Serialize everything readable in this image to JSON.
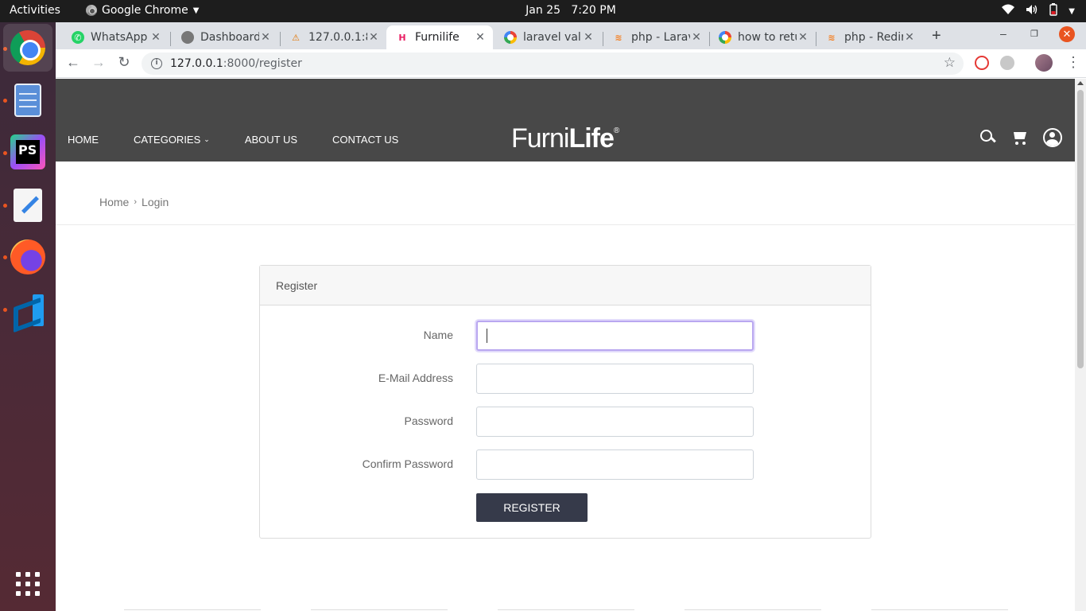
{
  "os": {
    "activities": "Activities",
    "app_name": "Google Chrome",
    "date": "Jan 25",
    "time": "7:20 PM"
  },
  "browser": {
    "tabs": [
      {
        "label": "WhatsApp",
        "icon": "whatsapp-icon"
      },
      {
        "label": "Dashboard",
        "icon": "globe-icon"
      },
      {
        "label": "127.0.0.1:8",
        "icon": "warning-icon"
      },
      {
        "label": "Furnilife",
        "icon": "furnilife-icon",
        "active": true
      },
      {
        "label": "laravel valid",
        "icon": "google-icon"
      },
      {
        "label": "php - Larav",
        "icon": "stackoverflow-icon"
      },
      {
        "label": "how to retu",
        "icon": "google-icon"
      },
      {
        "label": "php - Redir",
        "icon": "stackoverflow-icon"
      }
    ],
    "url_host": "127.0.0.1",
    "url_path": ":8000/register"
  },
  "site": {
    "nav": [
      "HOME",
      "CATEGORIES",
      "ABOUT US",
      "CONTACT US"
    ],
    "logo_light": "Furni",
    "logo_bold": "Life",
    "logo_mark": "®",
    "breadcrumb": {
      "home": "Home",
      "current": "Login"
    }
  },
  "form": {
    "title": "Register",
    "fields": [
      {
        "label": "Name",
        "value": ""
      },
      {
        "label": "E-Mail Address",
        "value": ""
      },
      {
        "label": "Password",
        "value": ""
      },
      {
        "label": "Confirm Password",
        "value": ""
      }
    ],
    "submit": "REGISTER"
  },
  "colors": {
    "header_bg": "#484848",
    "button_bg": "#363a4a",
    "focus_ring": "#b9a7f0",
    "ubuntu_accent": "#e95420"
  }
}
